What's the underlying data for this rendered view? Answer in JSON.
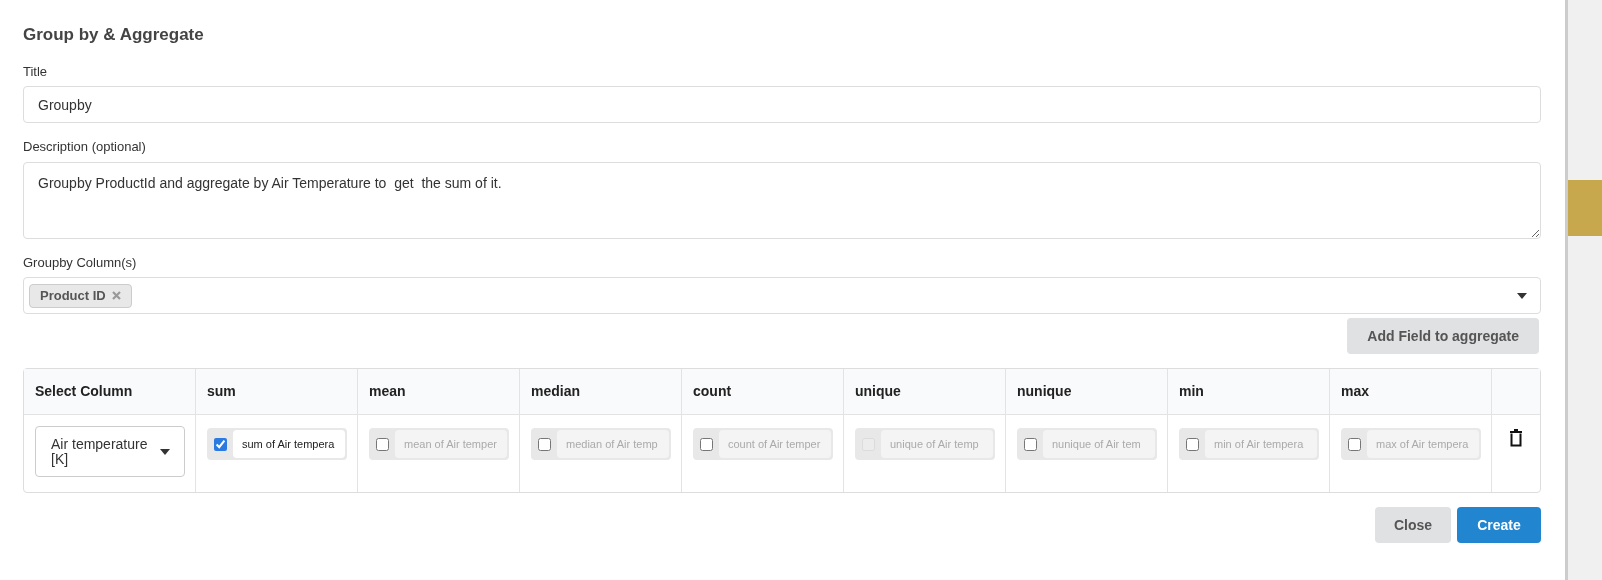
{
  "dialog": {
    "title": "Group by & Aggregate"
  },
  "title_field": {
    "label": "Title",
    "value": "Groupby"
  },
  "description_field": {
    "label": "Description (optional)",
    "value": "Groupby ProductId and aggregate by Air Temperature to  get  the sum of it."
  },
  "groupby_field": {
    "label": "Groupby Column(s)",
    "tags": [
      "Product ID"
    ]
  },
  "add_button": "Add Field to aggregate",
  "table": {
    "columns": [
      "Select Column",
      "sum",
      "mean",
      "median",
      "count",
      "unique",
      "nunique",
      "min",
      "max"
    ],
    "rows": [
      {
        "column": "Air temperature [K]",
        "aggregates": [
          {
            "checked": true,
            "disabled": false,
            "value": "sum of Air tempera"
          },
          {
            "checked": false,
            "disabled": false,
            "placeholder": "mean of Air temper"
          },
          {
            "checked": false,
            "disabled": false,
            "placeholder": "median of Air temp"
          },
          {
            "checked": false,
            "disabled": false,
            "placeholder": "count of Air temper"
          },
          {
            "checked": false,
            "disabled": true,
            "placeholder": "unique of Air temp"
          },
          {
            "checked": false,
            "disabled": false,
            "placeholder": "nunique of Air tem"
          },
          {
            "checked": false,
            "disabled": false,
            "placeholder": "min of Air tempera"
          },
          {
            "checked": false,
            "disabled": false,
            "placeholder": "max of Air tempera"
          }
        ]
      }
    ]
  },
  "buttons": {
    "close": "Close",
    "create": "Create"
  }
}
